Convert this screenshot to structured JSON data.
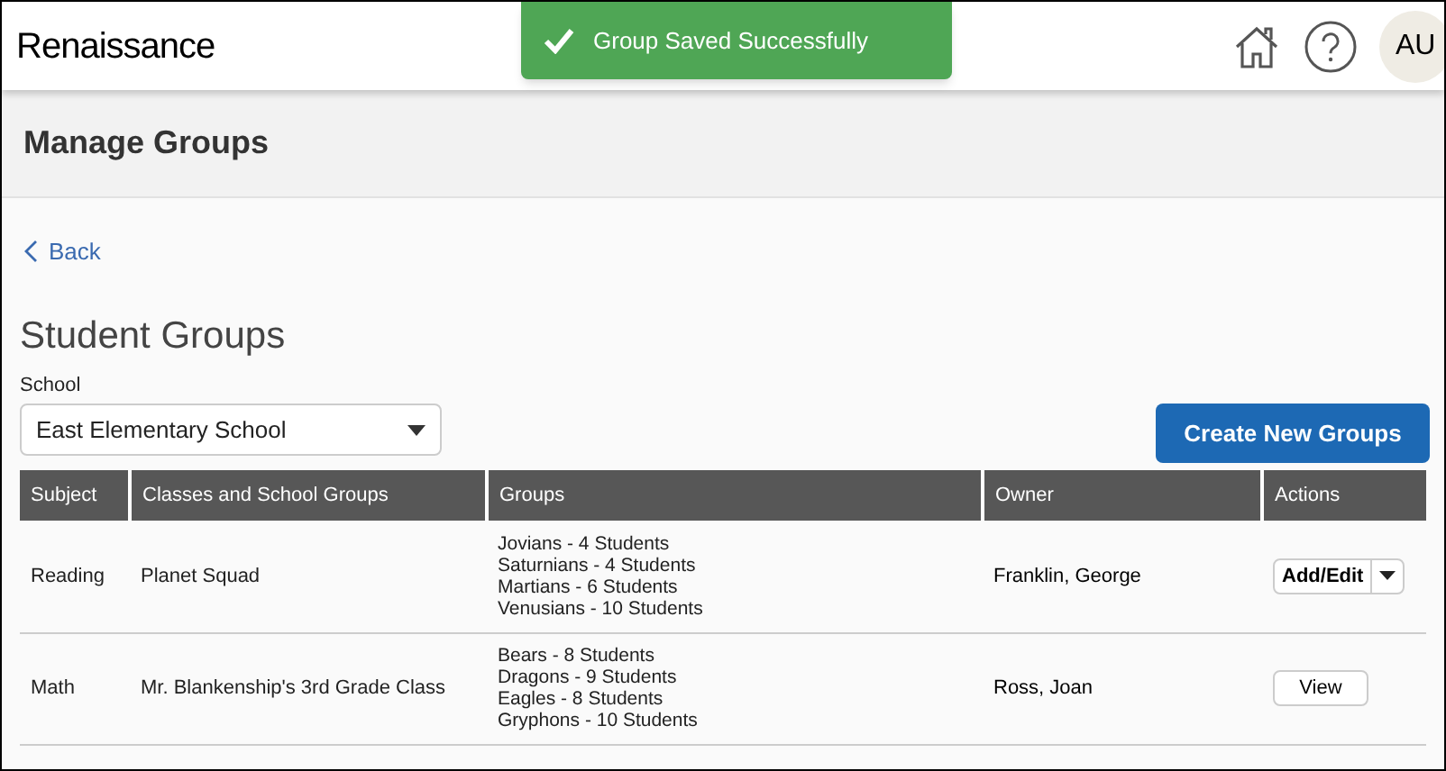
{
  "header": {
    "logo": "Renaissance",
    "avatar": "AU"
  },
  "toast": {
    "message": "Group Saved Successfully"
  },
  "page_title": "Manage Groups",
  "back_link": "Back",
  "section_title": "Student Groups",
  "school_select": {
    "label": "School",
    "value": "East Elementary School"
  },
  "create_button": "Create New Groups",
  "table": {
    "columns": [
      "Subject",
      "Classes and School Groups",
      "Groups",
      "Owner",
      "Actions"
    ],
    "rows": [
      {
        "subject": "Reading",
        "class": "Planet Squad",
        "groups": [
          "Jovians - 4 Students",
          "Saturnians - 4 Students",
          "Martians - 6 Students",
          "Venusians - 10 Students"
        ],
        "owner": "Franklin, George",
        "action": {
          "kind": "split",
          "label": "Add/Edit"
        }
      },
      {
        "subject": "Math",
        "class": "Mr. Blankenship's 3rd Grade Class",
        "groups": [
          "Bears - 8 Students",
          "Dragons - 9 Students",
          "Eagles - 8 Students",
          "Gryphons - 10 Students"
        ],
        "owner": "Ross, Joan",
        "action": {
          "kind": "button",
          "label": "View"
        }
      }
    ]
  }
}
